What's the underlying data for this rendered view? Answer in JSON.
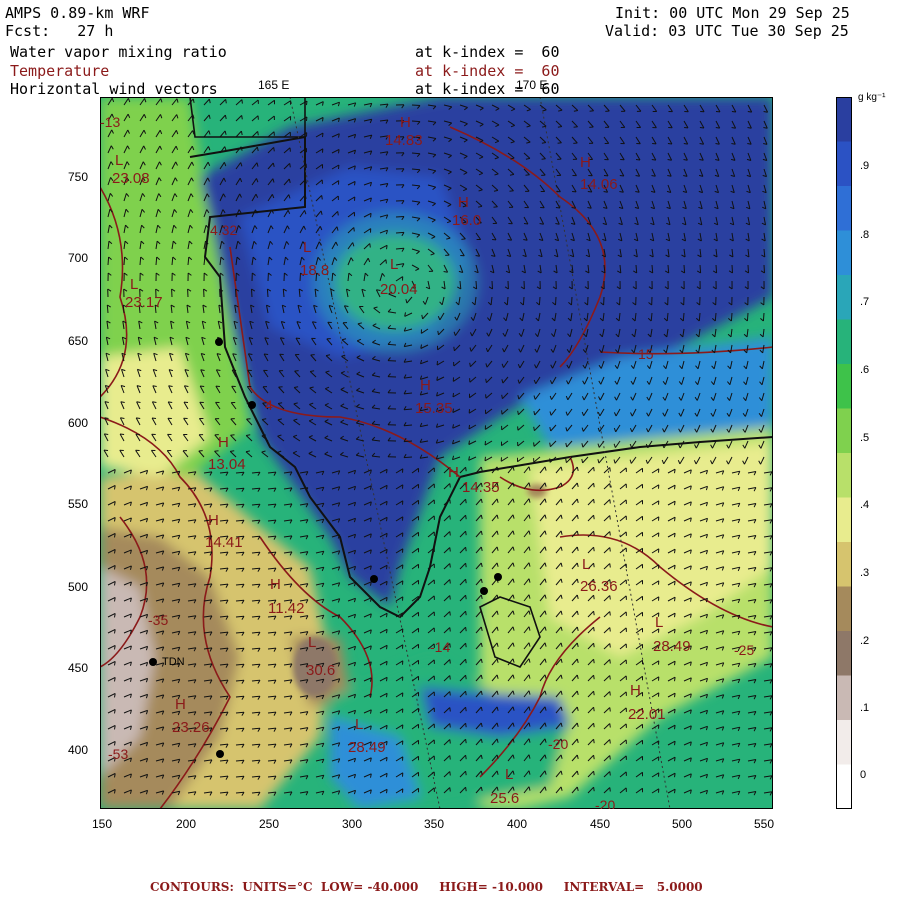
{
  "header": {
    "model": "AMPS 0.89-km WRF",
    "forecast": "Fcst:   27 h",
    "init": "Init: 00 UTC Mon 29 Sep 25",
    "valid": "Valid: 03 UTC Tue 30 Sep 25",
    "fields": [
      {
        "name": "Water vapor mixing ratio",
        "level": "at k-index =  60"
      },
      {
        "name": "Temperature",
        "level": "at k-index =  60"
      },
      {
        "name": "Horizontal wind vectors",
        "level": "at k-index =  60"
      }
    ]
  },
  "map": {
    "x_ticks": [
      "150",
      "200",
      "250",
      "300",
      "350",
      "400",
      "450",
      "500",
      "550"
    ],
    "y_ticks": [
      "750",
      "700",
      "650",
      "600",
      "550",
      "500",
      "450",
      "400"
    ],
    "meridian_labels": [
      "165 E",
      "170 E"
    ],
    "extrema": [
      {
        "type": "H",
        "value": "14.83"
      },
      {
        "type": "H",
        "value": "14.06"
      },
      {
        "type": "L",
        "value": "23.08"
      },
      {
        "type": "H",
        "value": "16.0"
      },
      {
        "type": "L",
        "value": "18.8"
      },
      {
        "type": "L",
        "value": "20.04"
      },
      {
        "type": "L",
        "value": "23.17"
      },
      {
        "type": "H",
        "value": "15.35"
      },
      {
        "type": "H",
        "value": "13.04"
      },
      {
        "type": "H",
        "value": "14.35"
      },
      {
        "type": "H",
        "value": "14.41"
      },
      {
        "type": "L",
        "value": "26.36"
      },
      {
        "type": "H",
        "value": "11.42"
      },
      {
        "type": "L",
        "value": "28.49"
      },
      {
        "type": "L",
        "value": "30.6"
      },
      {
        "type": "H",
        "value": "23.26"
      },
      {
        "type": "L",
        "value": "28.49"
      },
      {
        "type": "H",
        "value": "22.01"
      },
      {
        "type": "L",
        "value": "25.6"
      }
    ],
    "contour_labels": [
      "4.32",
      "15",
      "-35",
      "-53",
      "-25",
      "-20",
      "-20",
      "-14",
      "-13",
      "4"
    ],
    "station_label": "TDN"
  },
  "colorbar": {
    "unit": "g kg⁻¹",
    "ticks": [
      ".9",
      ".8",
      ".7",
      ".6",
      ".5",
      ".4",
      ".3",
      ".2",
      ".1",
      "0"
    ],
    "colors": [
      "#2a3fa0",
      "#2b52c4",
      "#2f6fd6",
      "#2e8fd8",
      "#2aa6b8",
      "#27b37a",
      "#3ec24a",
      "#7fd14e",
      "#b8e06a",
      "#e8ec8e",
      "#d6c46e",
      "#a58a5c",
      "#8e7868",
      "#c9b9b4",
      "#f2ecea",
      "#ffffff"
    ]
  },
  "footer": {
    "text": "CONTOURS:  UNITS=°C  LOW= -40.000     HIGH= -10.000     INTERVAL=   5.0000"
  }
}
